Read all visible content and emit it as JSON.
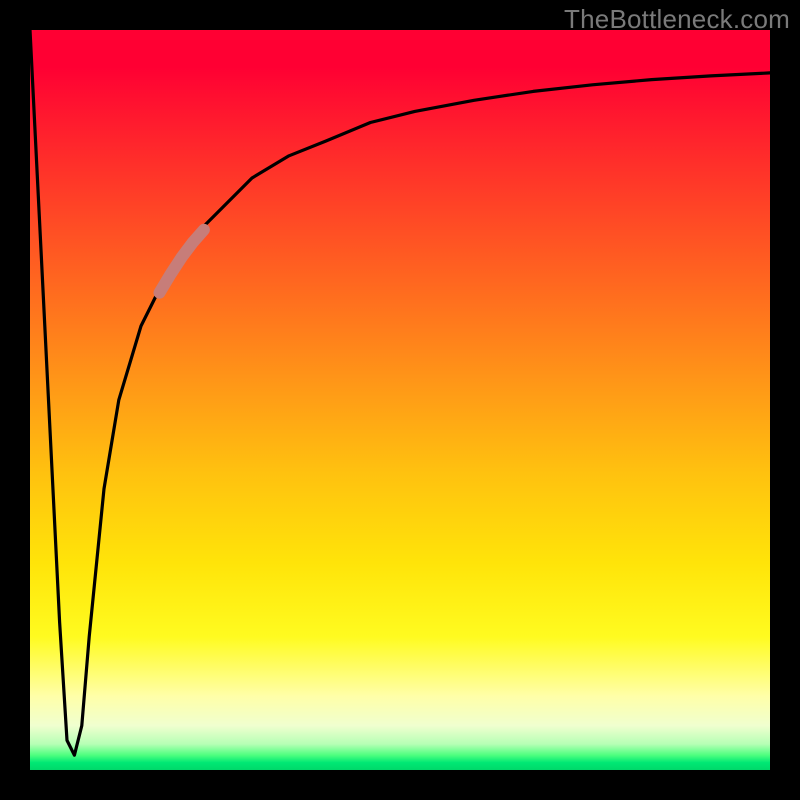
{
  "watermark": "TheBottleneck.com",
  "colors": {
    "frame": "#000000",
    "curve": "#000000",
    "highlight": "#c77d79"
  },
  "chart_data": {
    "type": "line",
    "title": "",
    "xlabel": "",
    "ylabel": "",
    "xlim": [
      0,
      100
    ],
    "ylim": [
      0,
      100
    ],
    "grid": false,
    "legend": false,
    "annotation": "Bottleneck curve with highlighted segment on rising branch",
    "series": [
      {
        "name": "bottleneck-curve",
        "x": [
          0,
          2,
          4,
          5,
          6,
          7,
          8,
          10,
          12,
          15,
          18,
          22,
          26,
          30,
          35,
          40,
          46,
          52,
          60,
          68,
          76,
          84,
          92,
          100
        ],
        "y": [
          100,
          60,
          20,
          4,
          2,
          6,
          18,
          38,
          50,
          60,
          66,
          72,
          76,
          80,
          83,
          85,
          87.5,
          89,
          90.5,
          91.7,
          92.6,
          93.3,
          93.8,
          94.2
        ]
      },
      {
        "name": "highlight-segment",
        "x": [
          17.5,
          19,
          20.5,
          22,
          23.5
        ],
        "y": [
          64.5,
          67,
          69.3,
          71.3,
          73
        ]
      }
    ],
    "gradient_stops": [
      {
        "pos": 0,
        "color": "#ff0033"
      },
      {
        "pos": 35,
        "color": "#ff6a1f"
      },
      {
        "pos": 60,
        "color": "#ffc20f"
      },
      {
        "pos": 82,
        "color": "#fffb20"
      },
      {
        "pos": 94,
        "color": "#f0ffcf"
      },
      {
        "pos": 100,
        "color": "#00d86a"
      }
    ]
  }
}
